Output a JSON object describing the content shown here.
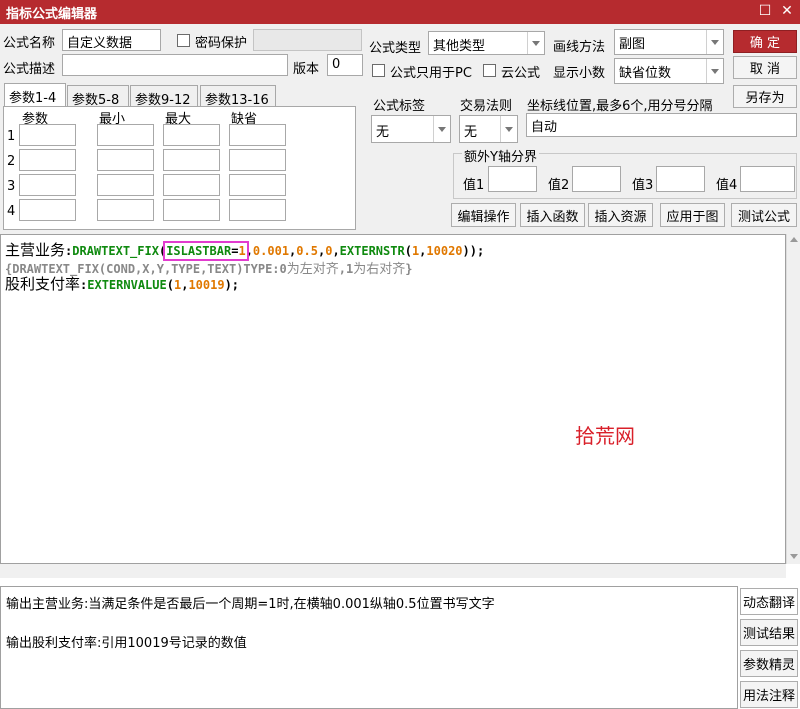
{
  "window": {
    "title": "指标公式编辑器",
    "minimize_glyph": "☐",
    "close_glyph": "✕"
  },
  "form": {
    "name_label": "公式名称",
    "name_value": "自定义数据",
    "password_label": "密码保护",
    "password_checked": false,
    "desc_label": "公式描述",
    "desc_value": "",
    "version_label": "版本",
    "version_value": "0",
    "type_label": "公式类型",
    "type_value": "其他类型",
    "draw_label": "画线方法",
    "draw_value": "副图",
    "pc_only_label": "公式只用于PC",
    "cloud_label": "云公式",
    "decimals_label": "显示小数",
    "decimals_value": "缺省位数",
    "formula_tag_label": "公式标签",
    "formula_tag_value": "无",
    "trade_rule_label": "交易法则",
    "trade_rule_value": "无",
    "coord_label": "坐标线位置,最多6个,用分号分隔",
    "coord_value": "自动"
  },
  "buttons": {
    "ok": "确  定",
    "cancel": "取  消",
    "save_as": "另存为",
    "edit_ops": "编辑操作",
    "insert_func": "插入函数",
    "insert_res": "插入资源",
    "apply_chart": "应用于图",
    "test_formula": "测试公式"
  },
  "params": {
    "tabs": [
      "参数1-4",
      "参数5-8",
      "参数9-12",
      "参数13-16"
    ],
    "headers": [
      "参数",
      "最小",
      "最大",
      "缺省"
    ],
    "rows": [
      "1",
      "2",
      "3",
      "4"
    ]
  },
  "yaxis": {
    "title": "额外Y轴分界",
    "labels": [
      "值1",
      "值2",
      "值3",
      "值4"
    ]
  },
  "code": {
    "l1_name": "主营业务",
    "l1_colon": ":",
    "l1_fn": "DRAWTEXT_FIX",
    "l1_open": "(",
    "l1_hl_text": "ISLASTBAR",
    "l1_hl_eq": "=",
    "l1_hl_num": "1",
    "l1_c1": ",",
    "l1_n1": "0.001",
    "l1_c2": ",",
    "l1_n2": "0.5",
    "l1_c3": ",",
    "l1_n3": "0",
    "l1_c4": ",",
    "l1_fn2": "EXTERNSTR",
    "l1_open2": "(",
    "l1_n4": "1",
    "l1_c5": ",",
    "l1_n5": "10020",
    "l1_close": "));",
    "l2_code": "{DRAWTEXT_FIX(COND,X,Y,TYPE,TEXT)TYPE:0",
    "l2_cn1": "为左对齐",
    "l2_sep": ",1",
    "l2_cn2": "为右对齐",
    "l2_end": "}",
    "l3_name": "股利支付率",
    "l3_colon": ":",
    "l3_fn": "EXTERNVALUE",
    "l3_open": "(",
    "l3_n1": "1",
    "l3_c1": ",",
    "l3_n2": "10019",
    "l3_close": ");",
    "watermark": "拾荒网"
  },
  "output": {
    "line1": "输出主营业务:当满足条件是否最后一个周期=1时,在横轴0.001纵轴0.5位置书写文字",
    "line2": "输出股利支付率:引用10019号记录的数值"
  },
  "side_buttons": [
    "动态翻译",
    "测试结果",
    "参数精灵",
    "用法注释"
  ],
  "colors": {
    "title_bar": "#b62b2f",
    "function": "#0f8a0f",
    "number": "#e07800",
    "highlight_box": "#e23ccf",
    "watermark": "#d9202a"
  }
}
